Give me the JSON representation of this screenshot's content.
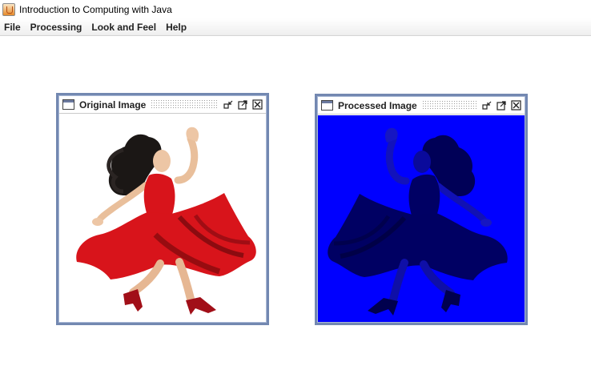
{
  "window": {
    "title": "Introduction to Computing with Java"
  },
  "menubar": {
    "items": [
      "File",
      "Processing",
      "Look and Feel",
      "Help"
    ]
  },
  "frames": {
    "original": {
      "title": "Original Image",
      "image_icon": "dancer-image"
    },
    "processed": {
      "title": "Processed Image",
      "image_icon": "dancer-image-blue-tinted"
    }
  },
  "colors": {
    "frame_border": "#7388b1",
    "processed_background": "#0000ff",
    "dress_red": "#d8141b"
  }
}
